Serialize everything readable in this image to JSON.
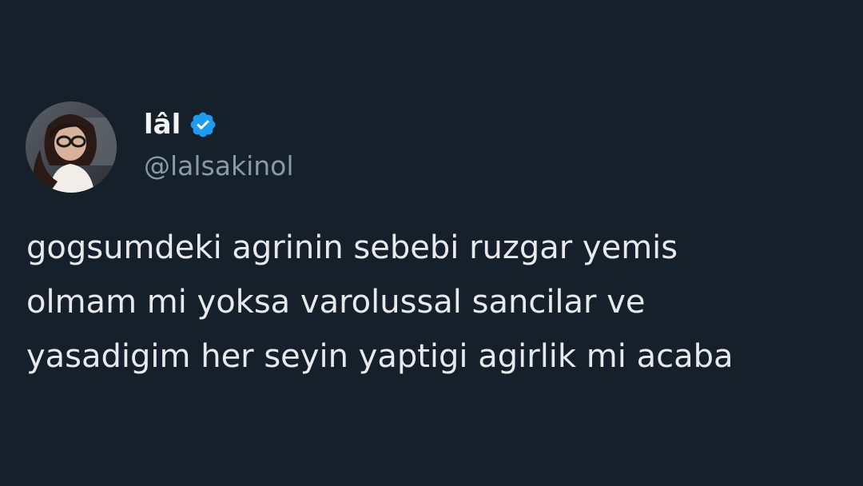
{
  "tweet": {
    "author": {
      "display_name": "lâl",
      "handle": "@lalsakinol",
      "verified": true,
      "avatar_icon": "profile-photo",
      "verified_icon": "verified-badge-icon"
    },
    "text_lines": [
      "gogsumdeki agrinin sebebi ruzgar yemis",
      "olmam mi yoksa varolussal sancilar ve",
      "yasadigim her seyin yaptigi agirlik mi acaba"
    ]
  },
  "colors": {
    "background": "#15202b",
    "text_primary": "#e7e9ea",
    "text_secondary": "#8b98a5",
    "verified_blue": "#1d9bf0"
  }
}
